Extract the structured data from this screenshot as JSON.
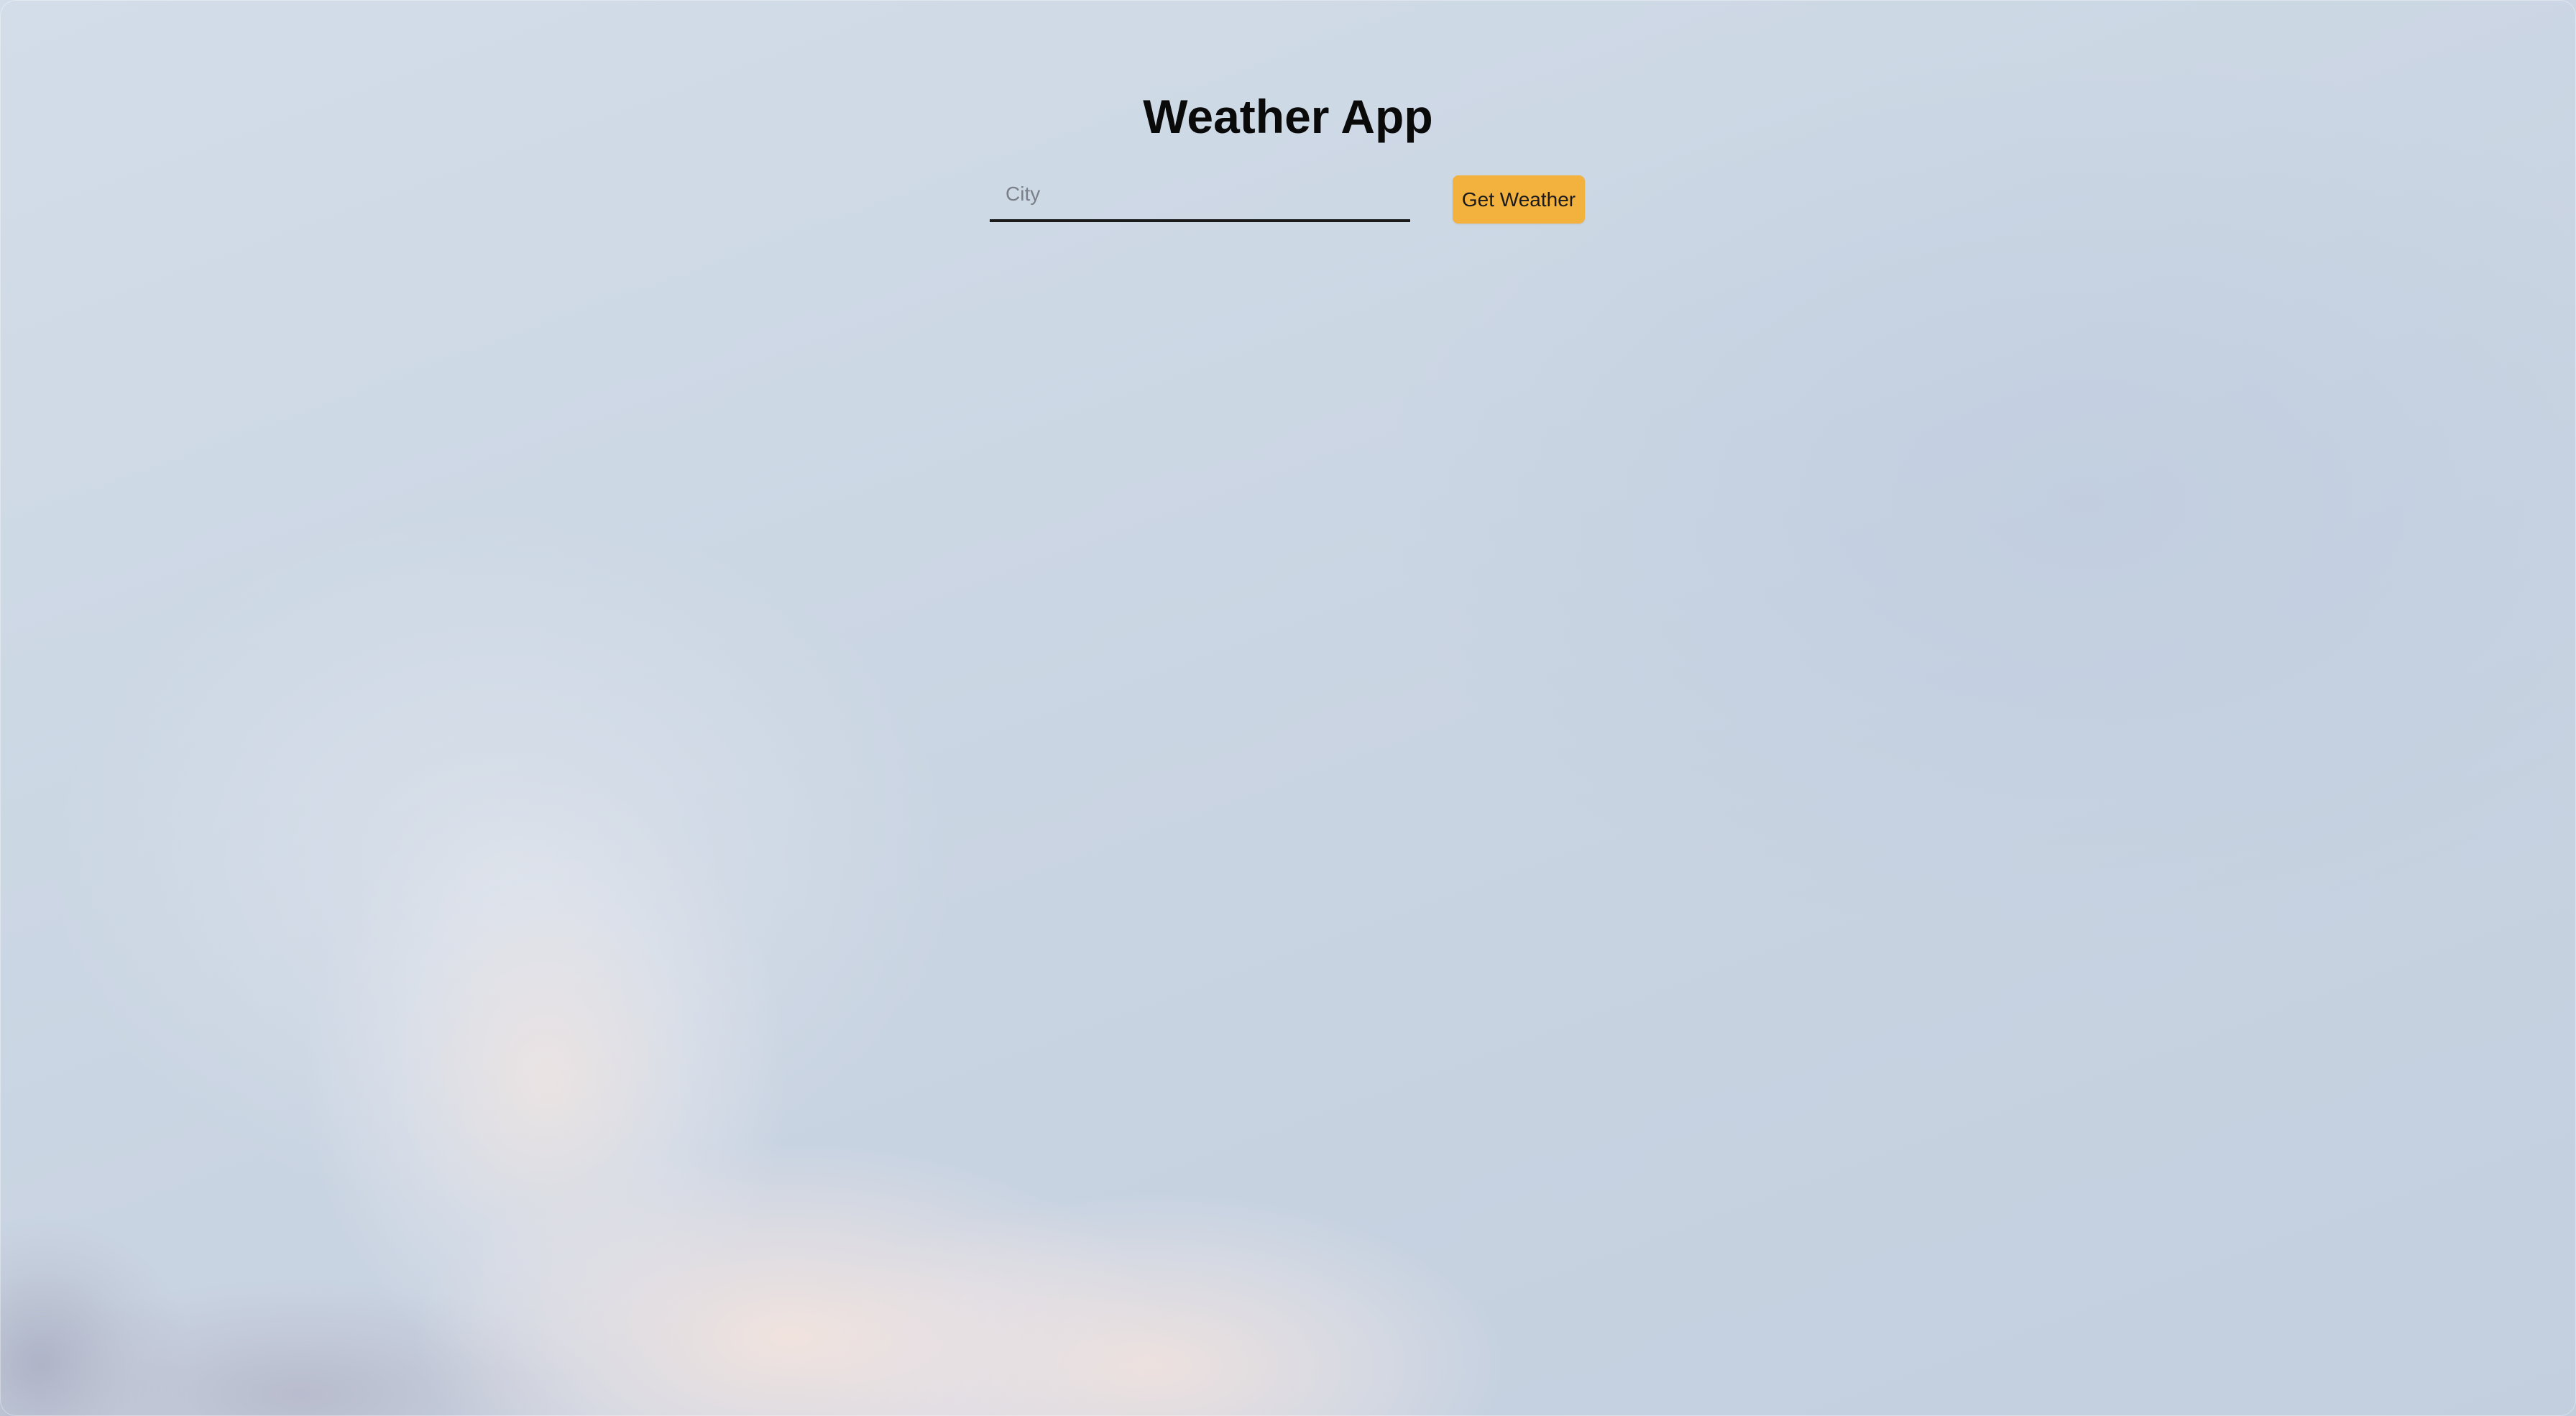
{
  "app": {
    "title": "Weather App"
  },
  "search": {
    "placeholder": "City",
    "value": "",
    "button_label": "Get Weather"
  },
  "colors": {
    "accent": "#f3b13d",
    "text": "#0a0a0a",
    "background": "#cdd8e6"
  }
}
